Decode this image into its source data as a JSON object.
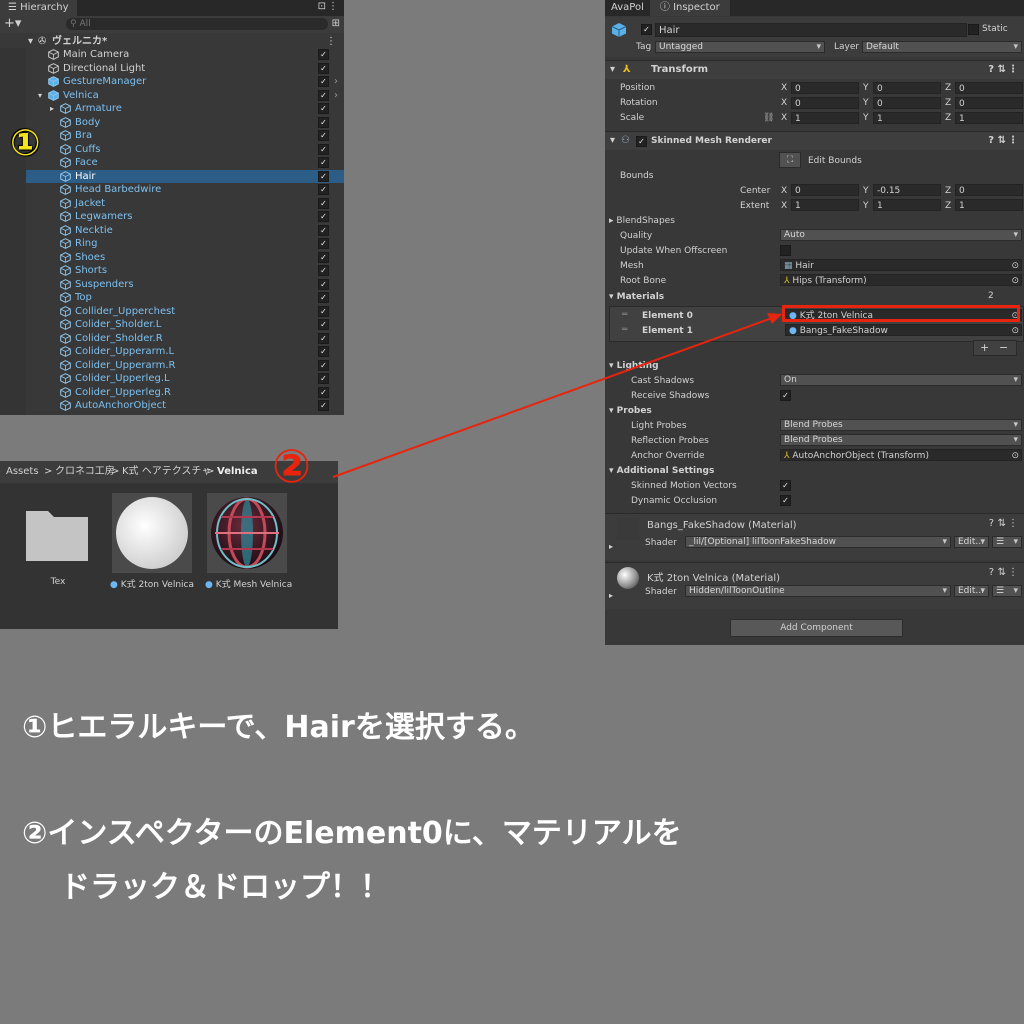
{
  "hierarchy": {
    "title": "Hierarchy",
    "search_placeholder": "All",
    "scene": "ヴェルニカ*",
    "items": [
      {
        "label": "Main Camera",
        "depth": 1,
        "kind": "object",
        "selected": false
      },
      {
        "label": "Directional Light",
        "depth": 1,
        "kind": "object",
        "selected": false
      },
      {
        "label": "GestureManager",
        "depth": 1,
        "kind": "prefab",
        "selected": false
      },
      {
        "label": "Velnica",
        "depth": 1,
        "kind": "prefab",
        "selected": false
      },
      {
        "label": "Armature",
        "depth": 2,
        "kind": "prefab",
        "selected": false
      },
      {
        "label": "Body",
        "depth": 2,
        "kind": "prefab",
        "selected": false
      },
      {
        "label": "Bra",
        "depth": 2,
        "kind": "prefab",
        "selected": false
      },
      {
        "label": "Cuffs",
        "depth": 2,
        "kind": "prefab",
        "selected": false
      },
      {
        "label": "Face",
        "depth": 2,
        "kind": "prefab",
        "selected": false
      },
      {
        "label": "Hair",
        "depth": 2,
        "kind": "prefab",
        "selected": true
      },
      {
        "label": "Head Barbedwire",
        "depth": 2,
        "kind": "prefab",
        "selected": false
      },
      {
        "label": "Jacket",
        "depth": 2,
        "kind": "prefab",
        "selected": false
      },
      {
        "label": "Legwamers",
        "depth": 2,
        "kind": "prefab",
        "selected": false
      },
      {
        "label": "Necktie",
        "depth": 2,
        "kind": "prefab",
        "selected": false
      },
      {
        "label": "Ring",
        "depth": 2,
        "kind": "prefab",
        "selected": false
      },
      {
        "label": "Shoes",
        "depth": 2,
        "kind": "prefab",
        "selected": false
      },
      {
        "label": "Shorts",
        "depth": 2,
        "kind": "prefab",
        "selected": false
      },
      {
        "label": "Suspenders",
        "depth": 2,
        "kind": "prefab",
        "selected": false
      },
      {
        "label": "Top",
        "depth": 2,
        "kind": "prefab",
        "selected": false
      },
      {
        "label": "Collider_Upperchest",
        "depth": 2,
        "kind": "prefab",
        "selected": false
      },
      {
        "label": "Colider_Sholder.L",
        "depth": 2,
        "kind": "prefab",
        "selected": false
      },
      {
        "label": "Colider_Sholder.R",
        "depth": 2,
        "kind": "prefab",
        "selected": false
      },
      {
        "label": "Colider_Upperarm.L",
        "depth": 2,
        "kind": "prefab",
        "selected": false
      },
      {
        "label": "Colider_Upperarm.R",
        "depth": 2,
        "kind": "prefab",
        "selected": false
      },
      {
        "label": "Colider_Upperleg.L",
        "depth": 2,
        "kind": "prefab",
        "selected": false
      },
      {
        "label": "Colider_Upperleg.R",
        "depth": 2,
        "kind": "prefab",
        "selected": false
      },
      {
        "label": "AutoAnchorObject",
        "depth": 2,
        "kind": "prefab",
        "selected": false
      }
    ]
  },
  "project": {
    "breadcrumb": [
      "Assets",
      "クロネコ工房",
      "K式 ヘアテクスチャ",
      "Velnica"
    ],
    "assets": [
      {
        "label": "Tex",
        "kind": "folder"
      },
      {
        "label": "K式 2ton Velnica",
        "kind": "material-white"
      },
      {
        "label": "K式 Mesh Velnica",
        "kind": "material-pattern"
      }
    ]
  },
  "inspector": {
    "tabs": [
      "AvaPol",
      "Inspector"
    ],
    "object_name": "Hair",
    "static_label": "Static",
    "tag_label": "Tag",
    "tag_value": "Untagged",
    "layer_label": "Layer",
    "layer_value": "Default",
    "transform": {
      "title": "Transform",
      "rows": [
        {
          "label": "Position",
          "x": "0",
          "y": "0",
          "z": "0"
        },
        {
          "label": "Rotation",
          "x": "0",
          "y": "0",
          "z": "0"
        },
        {
          "label": "Scale",
          "x": "1",
          "y": "1",
          "z": "1"
        }
      ]
    },
    "smr": {
      "title": "Skinned Mesh Renderer",
      "edit_bounds": "Edit Bounds",
      "bounds_label": "Bounds",
      "center_label": "Center",
      "center": {
        "x": "0",
        "y": "-0.15",
        "z": "0"
      },
      "extent_label": "Extent",
      "extent": {
        "x": "1",
        "y": "1",
        "z": "1"
      },
      "blendshapes": "BlendShapes",
      "quality_label": "Quality",
      "quality_value": "Auto",
      "offscreen_label": "Update When Offscreen",
      "mesh_label": "Mesh",
      "mesh_value": "Hair",
      "rootbone_label": "Root Bone",
      "rootbone_value": "Hips (Transform)",
      "materials_label": "Materials",
      "materials_count": "2",
      "elements": [
        {
          "label": "Element 0",
          "value": "K式 2ton Velnica"
        },
        {
          "label": "Element 1",
          "value": "Bangs_FakeShadow"
        }
      ],
      "lighting": "Lighting",
      "cast_label": "Cast Shadows",
      "cast_value": "On",
      "receive_label": "Receive Shadows",
      "probes": "Probes",
      "light_probes_label": "Light Probes",
      "light_probes_value": "Blend Probes",
      "refl_probes_label": "Reflection Probes",
      "refl_probes_value": "Blend Probes",
      "anchor_label": "Anchor Override",
      "anchor_value": "AutoAnchorObject (Transform)",
      "additional": "Additional Settings",
      "motion_label": "Skinned Motion Vectors",
      "occlusion_label": "Dynamic Occlusion"
    },
    "materials": [
      {
        "title": "Bangs_FakeShadow (Material)",
        "shader_label": "Shader",
        "shader": "_lil/[Optional] lilToonFakeShadow",
        "edit": "Edit..."
      },
      {
        "title": "K式 2ton Velnica (Material)",
        "shader_label": "Shader",
        "shader": "Hidden/lilToonOutline",
        "edit": "Edit..."
      }
    ],
    "add_component": "Add Component"
  },
  "annotations": {
    "marker1": "①",
    "marker2": "②",
    "step1": "①ヒエラルキーで、Hairを選択する。",
    "step2_line1": "②インスペクターのElement0に、マテリアルを",
    "step2_line2": "ドラック＆ドロップ！！",
    "highlight_color": "#e8240e",
    "marker_color": "#f5e21a"
  }
}
